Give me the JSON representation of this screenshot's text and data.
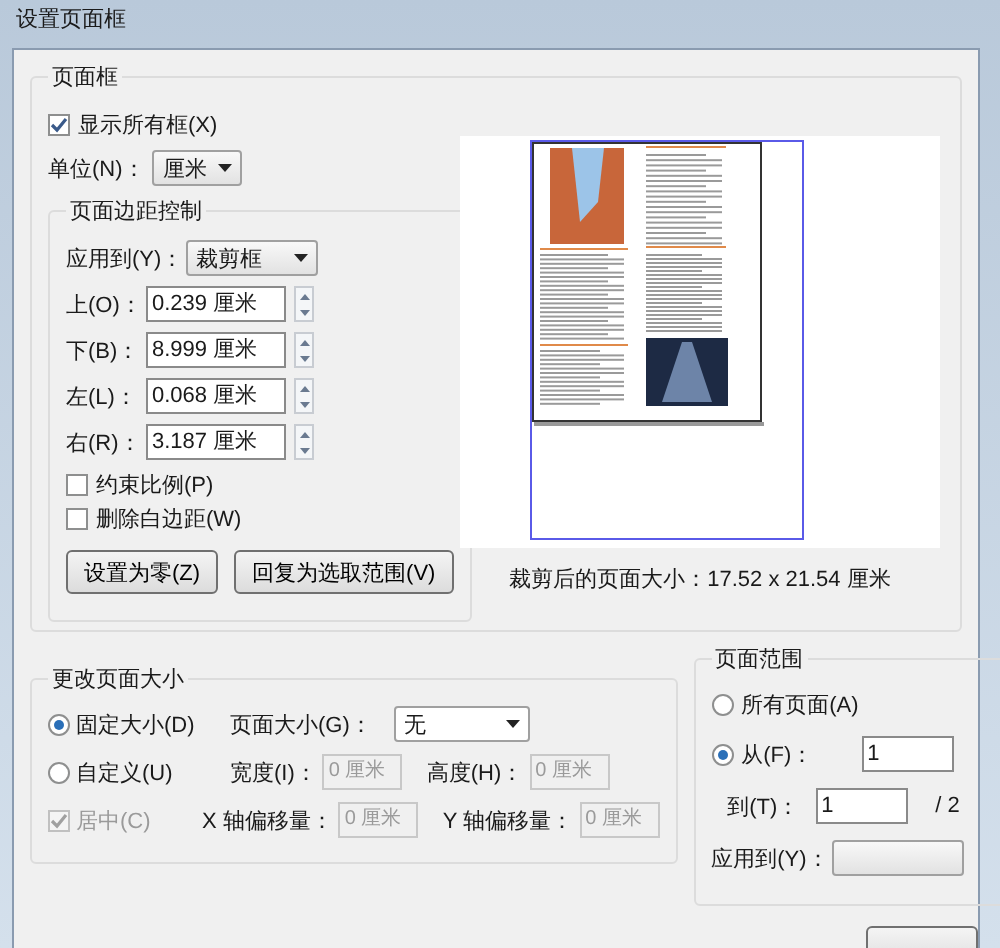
{
  "window": {
    "title": "设置页面框"
  },
  "page_box": {
    "title": "页面框",
    "show_all": {
      "label": "显示所有框(X)",
      "checked": true
    },
    "unit": {
      "label": "单位(N)：",
      "value": "厘米"
    },
    "margins": {
      "title": "页面边距控制",
      "apply_to": {
        "label": "应用到(Y)：",
        "value": "裁剪框"
      },
      "fields": [
        {
          "label": "上(O)：",
          "value": "0.239 厘米"
        },
        {
          "label": "下(B)：",
          "value": "8.999 厘米"
        },
        {
          "label": "左(L)：",
          "value": "0.068 厘米"
        },
        {
          "label": "右(R)：",
          "value": "3.187 厘米"
        }
      ],
      "checkboxes": [
        {
          "label": "约束比例(P)",
          "checked": false
        },
        {
          "label": "删除白边距(W)",
          "checked": false
        }
      ],
      "buttons": [
        "设置为零(Z)",
        "回复为选取范围(V)"
      ]
    },
    "preview": {
      "caption": "裁剪后的页面大小：17.52 x 21.54 厘米"
    }
  },
  "resize": {
    "title": "更改页面大小",
    "options": [
      {
        "label": "固定大小(D)",
        "selected": true
      },
      {
        "label": "自定义(U)",
        "selected": false
      }
    ],
    "page_size": {
      "label": "页面大小(G)：",
      "value": "无"
    },
    "width": {
      "label": "宽度(I)：",
      "value": "0 厘米",
      "disabled": true
    },
    "height": {
      "label": "高度(H)：",
      "value": "0 厘米",
      "disabled": true
    },
    "center": {
      "label": "居中(C)",
      "checked": true,
      "disabled": true
    },
    "x_offset": {
      "label": "X 轴偏移量：",
      "value": "0 厘米",
      "disabled": true
    },
    "y_offset": {
      "label": "Y 轴偏移量：",
      "value": "0 厘米",
      "disabled": true
    }
  },
  "page_range": {
    "title": "页面范围",
    "options": [
      {
        "label": "所有页面(A)",
        "selected": false
      },
      {
        "label": "从(F)：",
        "selected": true
      }
    ],
    "from_value": "1",
    "to": {
      "label": "到(T)：",
      "value": "1",
      "total": "/ 2"
    },
    "apply_to": {
      "label": "应用到(Y)："
    }
  }
}
